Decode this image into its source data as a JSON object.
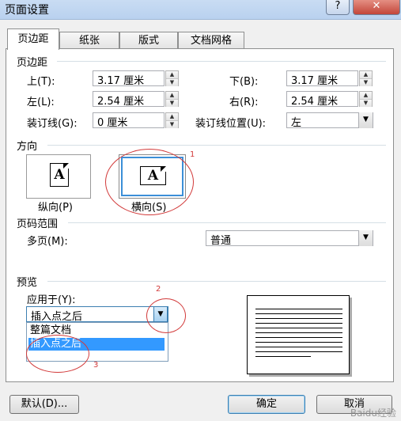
{
  "window": {
    "title": "页面设置",
    "help_label": "?",
    "close_label": "✕"
  },
  "tabs": [
    {
      "label": "页边距",
      "active": true
    },
    {
      "label": "纸张",
      "active": false
    },
    {
      "label": "版式",
      "active": false
    },
    {
      "label": "文档网格",
      "active": false
    }
  ],
  "margins": {
    "section_title": "页边距",
    "top_label": "上(T):",
    "top_value": "3.17 厘米",
    "bottom_label": "下(B):",
    "bottom_value": "3.17 厘米",
    "left_label": "左(L):",
    "left_value": "2.54 厘米",
    "right_label": "右(R):",
    "right_value": "2.54 厘米",
    "gutter_label": "装订线(G):",
    "gutter_value": "0 厘米",
    "gutter_pos_label": "装订线位置(U):",
    "gutter_pos_value": "左"
  },
  "orientation": {
    "section_title": "方向",
    "portrait_label": "纵向(P)",
    "landscape_label": "横向(S)",
    "icon_letter": "A",
    "selected": "landscape"
  },
  "pages": {
    "section_title": "页码范围",
    "multiple_label": "多页(M):",
    "multiple_value": "普通"
  },
  "preview": {
    "section_title": "预览",
    "apply_label": "应用于(Y):",
    "apply_value": "插入点之后",
    "options": [
      "整篇文档",
      "插入点之后"
    ],
    "selected_option": "插入点之后"
  },
  "annotations": {
    "mark1": "1",
    "mark2": "2",
    "mark3": "3",
    "color": "#d23a3a"
  },
  "buttons": {
    "default_label": "默认(D)...",
    "ok_label": "确定",
    "cancel_label": "取消"
  },
  "watermark": "Baidu经验"
}
